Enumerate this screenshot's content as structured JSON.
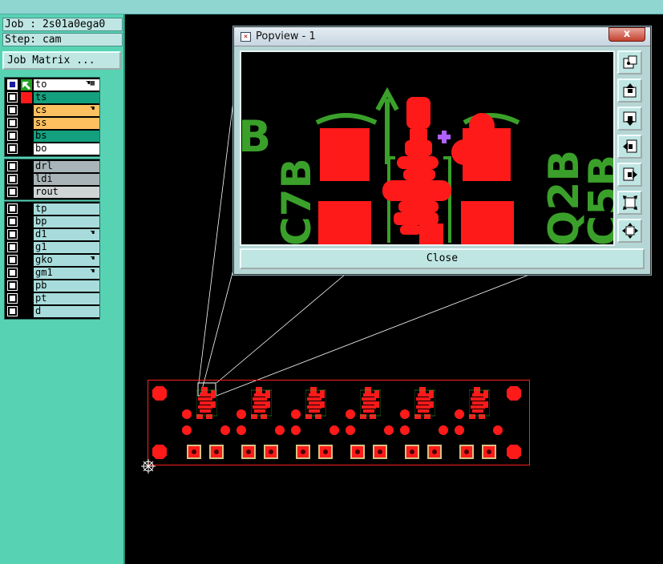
{
  "job": {
    "label": "Job : 2s01a0ega0",
    "step": "Step: cam",
    "matrix_button": "Job Matrix ..."
  },
  "layers": {
    "group1": [
      {
        "name": "to",
        "color": "#ffffff",
        "checked": true,
        "hand": true,
        "has_grid": true
      },
      {
        "name": "ts",
        "color": "#14a07e",
        "checked": false
      },
      {
        "name": "cs",
        "color": "#ffc060",
        "checked": false,
        "hand": true
      },
      {
        "name": "ss",
        "color": "#ffc060",
        "checked": false
      },
      {
        "name": "bs",
        "color": "#14a07e",
        "checked": false
      },
      {
        "name": "bo",
        "color": "#ffffff",
        "checked": false
      }
    ],
    "group2": [
      {
        "name": "drl",
        "color": "#a8b4b8",
        "checked": false
      },
      {
        "name": "ldi",
        "color": "#a8b4b8",
        "checked": false
      },
      {
        "name": "rout",
        "color": "#d0d4d4",
        "checked": false
      }
    ],
    "group3": [
      {
        "name": "tp",
        "color": "#a8dcdc",
        "checked": false
      },
      {
        "name": "bp",
        "color": "#a8dcdc",
        "checked": false
      },
      {
        "name": "d1",
        "color": "#a8dcdc",
        "checked": false,
        "hand": true
      },
      {
        "name": "g1",
        "color": "#a8dcdc",
        "checked": false
      },
      {
        "name": "gko",
        "color": "#a8dcdc",
        "checked": false,
        "hand": true
      },
      {
        "name": "gm1",
        "color": "#a8dcdc",
        "checked": false,
        "hand": true
      },
      {
        "name": "pb",
        "color": "#a8dcdc",
        "checked": false
      },
      {
        "name": "pt",
        "color": "#a8dcdc",
        "checked": false
      },
      {
        "name": "d",
        "color": "#a8dcdc",
        "checked": false
      }
    ]
  },
  "popview": {
    "title": "Popview - 1",
    "close_x": "x",
    "close_button": "Close",
    "silk_labels": {
      "b": "B",
      "c7b": "C7B",
      "q2b": "Q2B",
      "c5b": "C5B"
    }
  },
  "colors": {
    "copper": "#ff1a1a",
    "silk": "#3aa02a",
    "marker": "#b060ff",
    "panel": "#57d3b4"
  }
}
